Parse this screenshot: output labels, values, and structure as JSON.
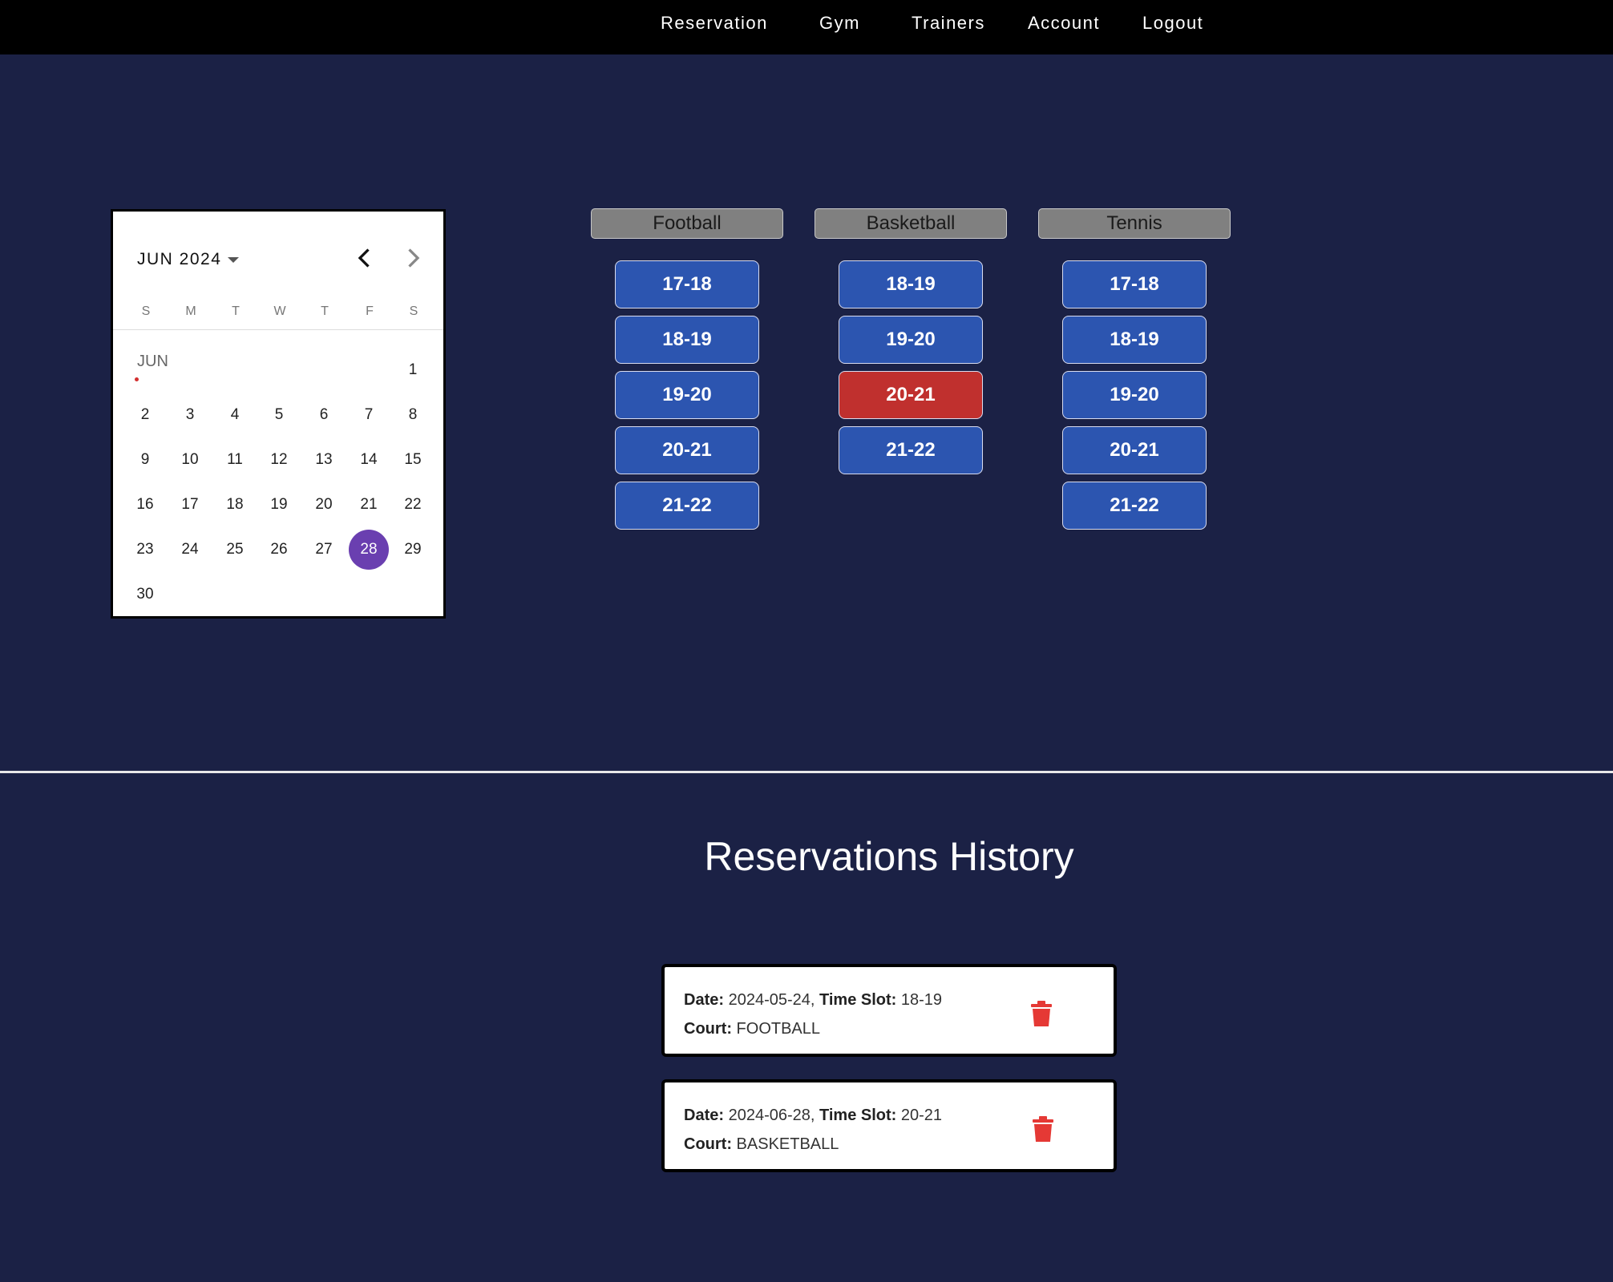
{
  "nav": {
    "items": [
      "Reservation",
      "Gym",
      "Trainers",
      "Account",
      "Logout"
    ]
  },
  "calendar": {
    "month_label": "JUN 2024",
    "month_tag": "JUN",
    "weekdays": [
      "S",
      "M",
      "T",
      "W",
      "T",
      "F",
      "S"
    ],
    "days": [
      "1",
      "2",
      "3",
      "4",
      "5",
      "6",
      "7",
      "8",
      "9",
      "10",
      "11",
      "12",
      "13",
      "14",
      "15",
      "16",
      "17",
      "18",
      "19",
      "20",
      "21",
      "22",
      "23",
      "24",
      "25",
      "26",
      "27",
      "28",
      "29",
      "30"
    ],
    "selected_day": "28",
    "icons": {
      "prev": "chevron-left-icon",
      "next": "chevron-right-icon",
      "dropdown": "caret-down-icon"
    }
  },
  "courts": [
    {
      "name": "Football",
      "slots": [
        "17-18",
        "18-19",
        "19-20",
        "20-21",
        "21-22"
      ],
      "reserved": []
    },
    {
      "name": "Basketball",
      "slots": [
        "18-19",
        "19-20",
        "20-21",
        "21-22"
      ],
      "reserved": [
        "20-21"
      ]
    },
    {
      "name": "Tennis",
      "slots": [
        "17-18",
        "18-19",
        "19-20",
        "20-21",
        "21-22"
      ],
      "reserved": []
    }
  ],
  "colors": {
    "background": "#1b2145",
    "slot_available": "#2c55b0",
    "slot_reserved": "#c0302e",
    "selected_day": "#6a3fb0",
    "trash": "#e53935"
  },
  "history": {
    "title": "Reservations History",
    "labels": {
      "date": "Date:",
      "time_slot": "Time Slot:",
      "court": "Court:"
    },
    "entries": [
      {
        "date": "2024-05-24",
        "time_slot": "18-19",
        "court": "FOOTBALL"
      },
      {
        "date": "2024-06-28",
        "time_slot": "20-21",
        "court": "BASKETBALL"
      }
    ],
    "delete_icon": "trash-icon"
  }
}
